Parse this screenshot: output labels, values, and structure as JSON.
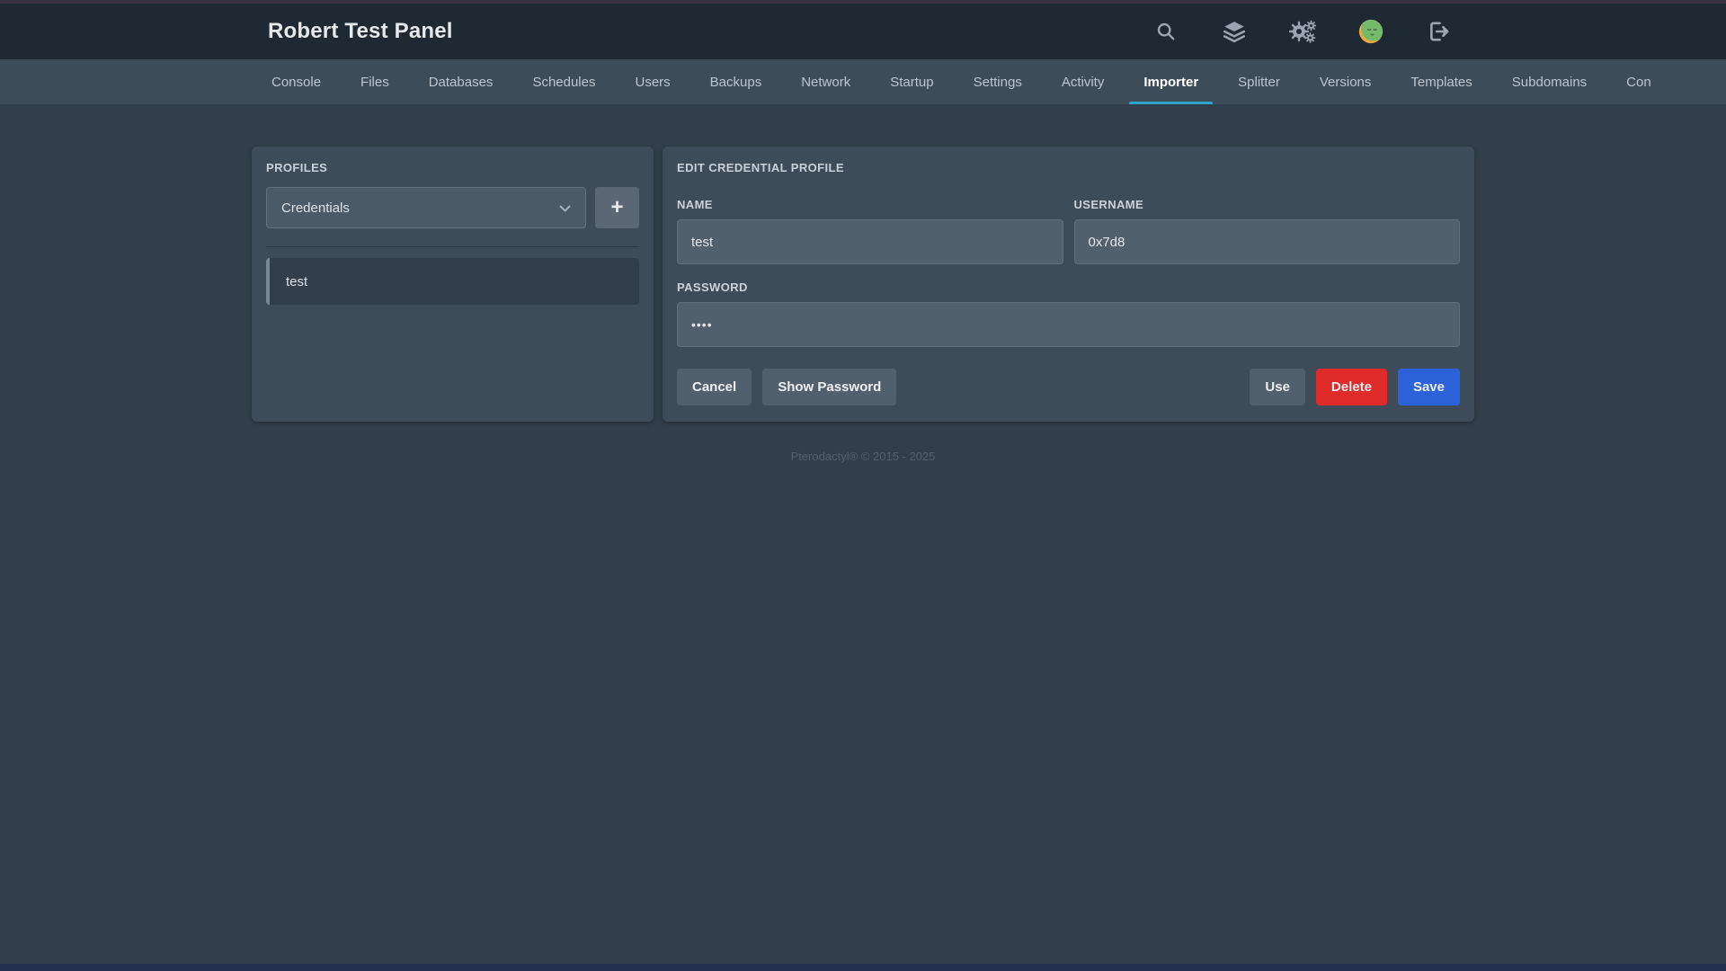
{
  "header": {
    "title": "Robert Test Panel",
    "icons": [
      "search-icon",
      "layers-icon",
      "cogs-icon",
      "user-avatar",
      "logout-icon"
    ]
  },
  "nav": {
    "tabs": [
      {
        "label": "Console",
        "active": false
      },
      {
        "label": "Files",
        "active": false
      },
      {
        "label": "Databases",
        "active": false
      },
      {
        "label": "Schedules",
        "active": false
      },
      {
        "label": "Users",
        "active": false
      },
      {
        "label": "Backups",
        "active": false
      },
      {
        "label": "Network",
        "active": false
      },
      {
        "label": "Startup",
        "active": false
      },
      {
        "label": "Settings",
        "active": false
      },
      {
        "label": "Activity",
        "active": false
      },
      {
        "label": "Importer",
        "active": true
      },
      {
        "label": "Splitter",
        "active": false
      },
      {
        "label": "Versions",
        "active": false
      },
      {
        "label": "Templates",
        "active": false
      },
      {
        "label": "Subdomains",
        "active": false
      },
      {
        "label": "Con",
        "active": false
      }
    ],
    "active_underline_color": "#2FA4C7"
  },
  "profiles_panel": {
    "title": "PROFILES",
    "select_value": "Credentials",
    "add_button_label": "+",
    "items": [
      "test"
    ]
  },
  "edit_panel": {
    "title": "EDIT CREDENTIAL PROFILE",
    "fields": {
      "name": {
        "label": "NAME",
        "value": "test"
      },
      "username": {
        "label": "USERNAME",
        "value": "0x7d8"
      },
      "password": {
        "label": "PASSWORD",
        "value": "••••"
      }
    },
    "buttons": {
      "cancel": "Cancel",
      "show_password": "Show Password",
      "use": "Use",
      "delete": "Delete",
      "save": "Save"
    }
  },
  "footer": {
    "copyright": "Pterodactyl® © 2015 - 2025"
  },
  "colors": {
    "header_bg": "#1F2933",
    "nav_bg": "#3E4C59",
    "body_bg": "#323F4B",
    "panel_bg": "#3E4C59",
    "input_bg": "#52606D",
    "input_border": "#616E7C",
    "accent_cyan": "#2FA4C7",
    "delete_red": "#E02B2B",
    "save_blue": "#2B62D9",
    "avatar_green": "#75B96B",
    "avatar_orange": "#F2A93B",
    "top_strip": "#3a3142",
    "bottom_strip": "#24314e"
  }
}
